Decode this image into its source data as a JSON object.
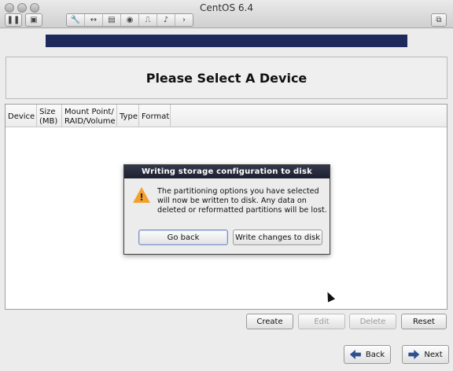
{
  "window": {
    "title": "CentOS 6.4"
  },
  "installer": {
    "heading": "Please Select A Device",
    "columns": [
      "Device",
      "Size\n(MB)",
      "Mount Point/\nRAID/Volume",
      "Type",
      "Format"
    ],
    "buttons": {
      "create": "Create",
      "edit": "Edit",
      "delete": "Delete",
      "reset": "Reset",
      "back": "Back",
      "next": "Next"
    }
  },
  "dialog": {
    "title": "Writing storage configuration to disk",
    "message": "The partitioning options you have selected will now be written to disk.  Any data on deleted or reformatted partitions will be lost.",
    "go_back": "Go back",
    "write": "Write changes to disk"
  },
  "colors": {
    "progress_bar": "#1f2a5c",
    "dialog_title_bg": "#1d2030",
    "warning_icon": "#f4a12c"
  }
}
